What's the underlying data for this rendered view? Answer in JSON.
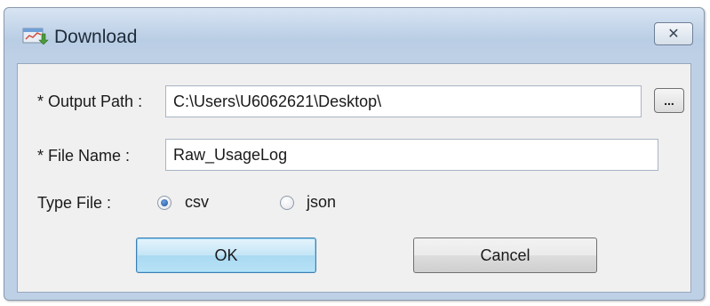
{
  "window": {
    "title": "Download",
    "close_glyph": "✕",
    "icon": "download-app-icon"
  },
  "form": {
    "output_path": {
      "label": "* Output Path :",
      "value": "C:\\Users\\U6062621\\Desktop\\",
      "browse_label": "..."
    },
    "file_name": {
      "label": "* File Name :",
      "value": "Raw_UsageLog"
    },
    "type_file": {
      "label": "Type File :",
      "options": [
        {
          "label": "csv",
          "checked": true
        },
        {
          "label": "json",
          "checked": false
        }
      ]
    }
  },
  "buttons": {
    "ok_label": "OK",
    "cancel_label": "Cancel"
  },
  "colors": {
    "title_bar": "#c9d9ec",
    "client_bg": "#f0f0f0",
    "ok_border": "#3c7fb1"
  }
}
